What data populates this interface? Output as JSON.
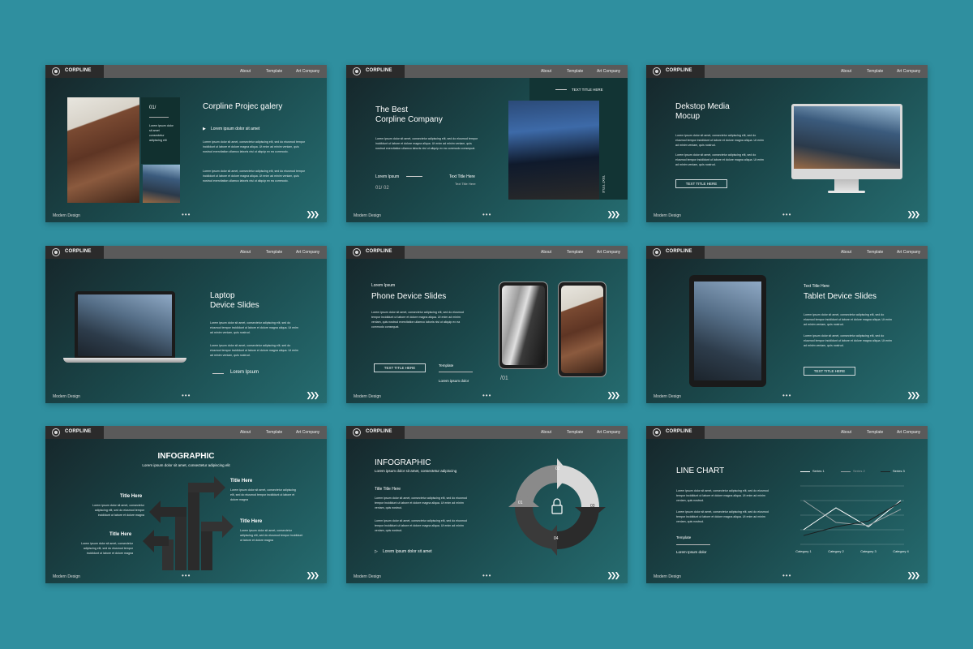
{
  "common": {
    "brand": "CORPLINE",
    "nav": [
      "About",
      "Template",
      "Art Company"
    ],
    "footer": "Modern Design"
  },
  "s1": {
    "num": "01/",
    "title": "Corpline Projec galery",
    "sub": "Lorem ipsum dolor sit amet",
    "side": "Lorem ipsum dolor sit amet consectetur adipiscing elit",
    "body1": "Lorem ipsum dolor sit amet, consectetur adipiscing elit, sed do eiusmod tempor incididunt ut labore et dolore magna aliqua. Ut enim ad minim veniam, quis nostrud exercitation ullamco laboris nisi ut aliquip ex ea commodo.",
    "body2": "Lorem ipsum dolor sit amet, consectetur adipiscing elit, sed do eiusmod tempor incididunt ut labore et dolore magna aliqua. Ut enim ad minim veniam, quis nostrud exercitation ullamco laboris nisi ut aliquip ex ea commodo."
  },
  "s2": {
    "tag": "TEXT TITLE HERE",
    "title": "The Best\nCorpline Company",
    "body": "Lorem ipsum dolor sit amet, consectetur adipiscing elit, sed do eiusmod tempor incididunt ut labore et dolore magna aliqua. Ut enim ad minim veniam, quis nostrud exercitation ullamco laboris nisi ut aliquip ex ea commodo consequat.",
    "lorem": "Lorem Ipsum",
    "texttitle": "Text Title Here",
    "textsub": "Text Title Here",
    "page": "01/ 02",
    "vertical": "TEXT TITLE"
  },
  "s3": {
    "title": "Dekstop Media\nMocup",
    "body1": "Lorem ipsum dolor sit amet, consectetur adipiscing elit, sed do eiusmod tempor incididunt ut labore et dolore magna aliqua. Ut enim ad minim veniam, quis nostrud.",
    "body2": "Lorem ipsum dolor sit amet, consectetur adipiscing elit, sed do eiusmod tempor incididunt ut labore et dolore magna aliqua. Ut enim ad minim veniam, quis nostrud.",
    "button": "TEXT TITLE HERE"
  },
  "s4": {
    "title": "Laptop\nDevice Slides",
    "body1": "Lorem ipsum dolor sit amet, consectetur adipiscing elit, sed do eiusmod tempor incididunt ut labore et dolore magna aliqua. Ut enim ad minim veniam, quis nostrud.",
    "body2": "Lorem ipsum dolor sit amet, consectetur adipiscing elit, sed do eiusmod tempor incididunt ut labore et dolore magna aliqua. Ut enim ad minim veniam, quis nostrud.",
    "lorem": "Lorem Ipsum"
  },
  "s5": {
    "kicker": "Lorem Ipsum",
    "title": "Phone Device Slides",
    "body": "Lorem ipsum dolor sit amet, consectetur adipiscing elit, sed do eiusmod tempor incididunt ut labore et dolore magna aliqua. Ut enim ad minim veniam, quis nostrud exercitation ullamco laboris nisi ut aliquip ex ea commodo consequat.",
    "button": "TEXT TITLE HERE",
    "template": "Template",
    "lorem": "Lorem ipsum dolor",
    "num": "/01"
  },
  "s6": {
    "kicker": "Text Title Here",
    "title": "Tablet Device Slides",
    "body1": "Lorem ipsum dolor sit amet, consectetur adipiscing elit, sed do eiusmod tempor incididunt ut labore et dolore magna aliqua. Ut enim ad minim veniam, quis nostrud.",
    "body2": "Lorem ipsum dolor sit amet, consectetur adipiscing elit, sed do eiusmod tempor incididunt ut labore et dolore magna aliqua. Ut enim ad minim veniam, quis nostrud.",
    "button": "TEXT TITLE HERE"
  },
  "s7": {
    "title": "INFOGRAPHIC",
    "sub": "Lorem ipsum dolor sit amet, consectetur adipiscing elit",
    "r1t": "Title Here",
    "r1b": "Lorem ipsum dolor sit amet, consectetur adipiscing elit, sed do eiusmod tempor incididunt ut labore et dolore magna",
    "r2t": "Title Here",
    "r2b": "Lorem ipsum dolor sit amet, consectetur adipiscing elit, sed do eiusmod tempor incididunt ut labore et dolore magna",
    "l1t": "Title Here",
    "l1b": "Lorem ipsum dolor sit amet, consectetur adipiscing elit, sed do eiusmod tempor incididunt ut labore et dolore magna",
    "l2t": "Title Here",
    "l2b": "Lorem ipsum dolor sit amet, consectetur adipiscing elit, sed do eiusmod tempor incididunt ut labore et dolore magna"
  },
  "s8": {
    "title": "INFOGRAPHIC",
    "sub": "Lorem ipsum dolor sit amet, consectetur adipiscing",
    "subtitle": "Title Title Here",
    "body1": "Lorem ipsum dolor sit amet, consectetur adipiscing elit, sed do eiusmod tempor incididunt ut labore et dolore magna aliqua. Ut enim ad minim veniam, quis nostrud.",
    "body2": "Lorem ipsum dolor sit amet, consectetur adipiscing elit, sed do eiusmod tempor incididunt ut labore et dolore magna aliqua. Ut enim ad minim veniam, quis nostrud.",
    "bullet": "Lorem Ipsum dolor sit amet",
    "labels": [
      "01",
      "02",
      "03",
      "04"
    ]
  },
  "s9": {
    "title": "LINE CHART",
    "body1": "Lorem ipsum dolor sit amet, consectetur adipiscing elit, sed do eiusmod tempor incididunt ut labore et dolore magna aliqua. Ut enim ad minim veniam, quis nostrud.",
    "body2": "Lorem ipsum dolor sit amet, consectetur adipiscing elit, sed do eiusmod tempor incididunt ut labore et dolore magna aliqua. Ut enim ad minim veniam, quis nostrud.",
    "template": "Template",
    "lorem": "Lorem Ipsum dolor",
    "legend": [
      "Series 1",
      "Series 2",
      "Series 3"
    ],
    "categories": [
      "Category 1",
      "Category 2",
      "Category 3",
      "Category 4"
    ]
  },
  "chart_data": {
    "type": "line",
    "categories": [
      "Category 1",
      "Category 2",
      "Category 3",
      "Category 4"
    ],
    "series": [
      {
        "name": "Series 1",
        "values": [
          1.0,
          2.5,
          1.2,
          3.0
        ]
      },
      {
        "name": "Series 2",
        "values": [
          3.0,
          1.5,
          1.3,
          2.4
        ]
      },
      {
        "name": "Series 3",
        "values": [
          0.6,
          1.2,
          1.6,
          2.9
        ]
      }
    ],
    "colors": [
      "#ffffff",
      "#9aa4a6",
      "#1b1f20"
    ],
    "ylim": [
      0,
      4
    ],
    "grid": true,
    "legend_position": "top"
  },
  "colors": {
    "background": "#2f8f9f",
    "topbar": "#5a5a5a",
    "brandbox": "#2b2b2b"
  }
}
